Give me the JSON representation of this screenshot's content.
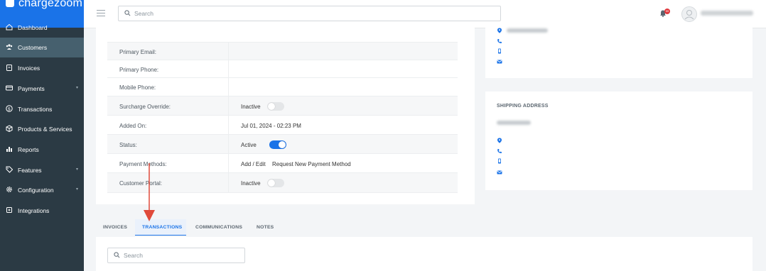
{
  "brand": {
    "name": "chargezoom",
    "color": "#1a73e8"
  },
  "sidebar": {
    "items": [
      {
        "label": "Dashboard",
        "icon": "home-icon",
        "has_submenu": false
      },
      {
        "label": "Customers",
        "icon": "users-icon",
        "has_submenu": false,
        "active": true
      },
      {
        "label": "Invoices",
        "icon": "clipboard-icon",
        "has_submenu": false
      },
      {
        "label": "Payments",
        "icon": "card-icon",
        "has_submenu": true
      },
      {
        "label": "Transactions",
        "icon": "dollar-icon",
        "has_submenu": false
      },
      {
        "label": "Products & Services",
        "icon": "box-icon",
        "has_submenu": false
      },
      {
        "label": "Reports",
        "icon": "bar-chart-icon",
        "has_submenu": false
      },
      {
        "label": "Features",
        "icon": "tag-icon",
        "has_submenu": true
      },
      {
        "label": "Configuration",
        "icon": "gear-icon",
        "has_submenu": true
      },
      {
        "label": "Integrations",
        "icon": "plug-icon",
        "has_submenu": false
      }
    ]
  },
  "topbar": {
    "search_placeholder": "Search",
    "notification_count": "99"
  },
  "details": {
    "rows": [
      {
        "key": "Primary Email:",
        "value": ""
      },
      {
        "key": "Primary Phone:",
        "value": ""
      },
      {
        "key": "Mobile Phone:",
        "value": ""
      },
      {
        "key": "Surcharge Override:",
        "value": "Inactive",
        "toggle": "off"
      },
      {
        "key": "Added On:",
        "value": "Jul 01, 2024 - 02:23 PM"
      },
      {
        "key": "Status:",
        "value": "Active",
        "toggle": "on"
      },
      {
        "key": "Payment Methods:",
        "link1": "Add / Edit",
        "link2": "Request New Payment Method"
      },
      {
        "key": "Customer Portal:",
        "value": "Inactive",
        "toggle": "off"
      }
    ]
  },
  "shipping": {
    "title": "SHIPPING ADDRESS"
  },
  "tabs": [
    {
      "label": "INVOICES"
    },
    {
      "label": "TRANSACTIONS",
      "active": true
    },
    {
      "label": "COMMUNICATIONS"
    },
    {
      "label": "NOTES"
    }
  ],
  "transactions": {
    "search_placeholder": "Search"
  },
  "annotation": {
    "color": "#e04a3a"
  }
}
